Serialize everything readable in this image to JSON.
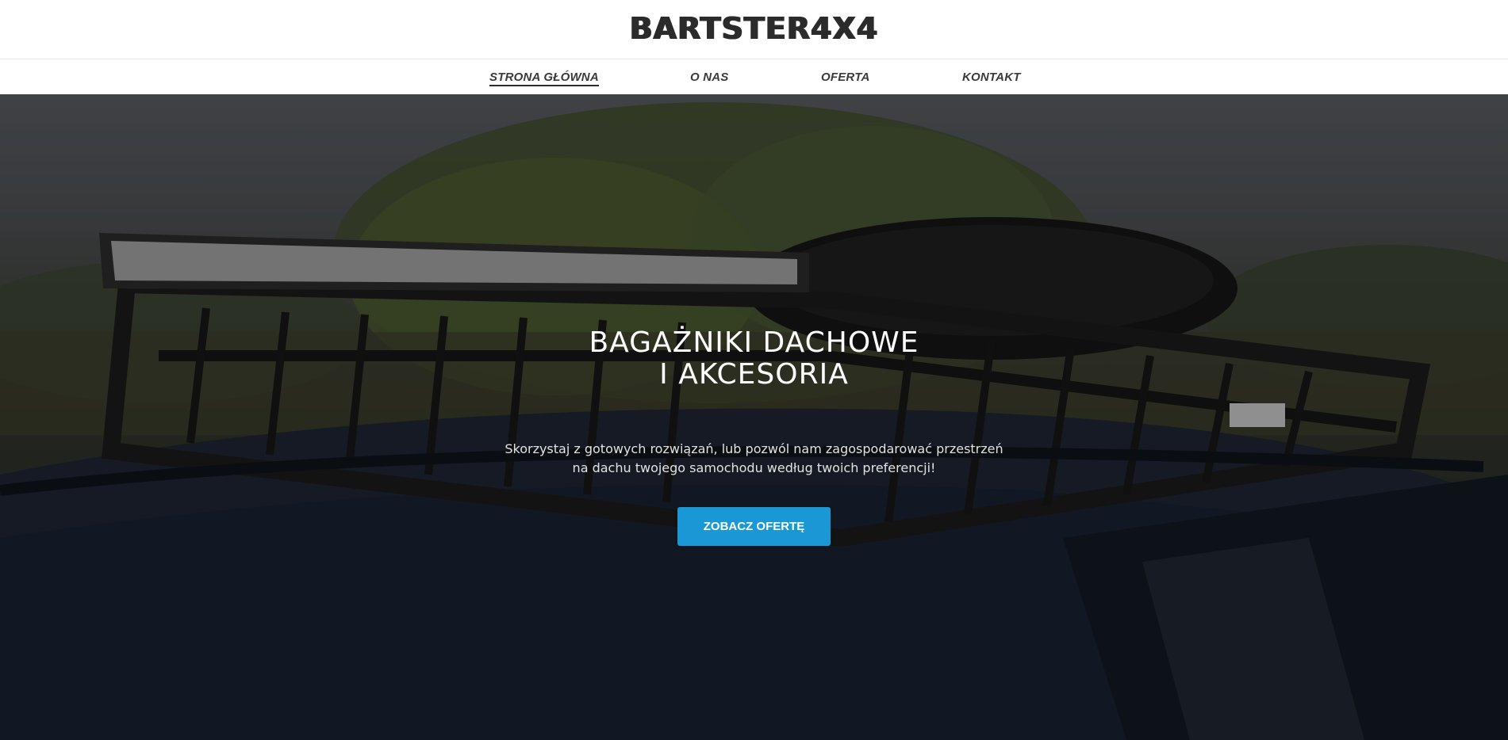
{
  "header": {
    "logo": "BARTSTER4X4"
  },
  "nav": {
    "items": [
      {
        "label": "STRONA GŁÓWNA",
        "active": true
      },
      {
        "label": "O NAS",
        "active": false
      },
      {
        "label": "OFERTA",
        "active": false
      },
      {
        "label": "KONTAKT",
        "active": false
      }
    ]
  },
  "hero": {
    "title_line1": "BAGAŻNIKI DACHOWE",
    "title_line2": "I AKCESORIA",
    "subtitle_line1": "Skorzystaj z gotowych rozwiązań, lub pozwól nam zagospodarować przestrzeń",
    "subtitle_line2": "na dachu twojego samochodu według twoich preferencji!",
    "cta_label": "ZOBACZ OFERTĘ"
  },
  "colors": {
    "accent": "#1a98d5",
    "nav_text": "#3a3a3a",
    "logo": "#2b2b2b"
  }
}
